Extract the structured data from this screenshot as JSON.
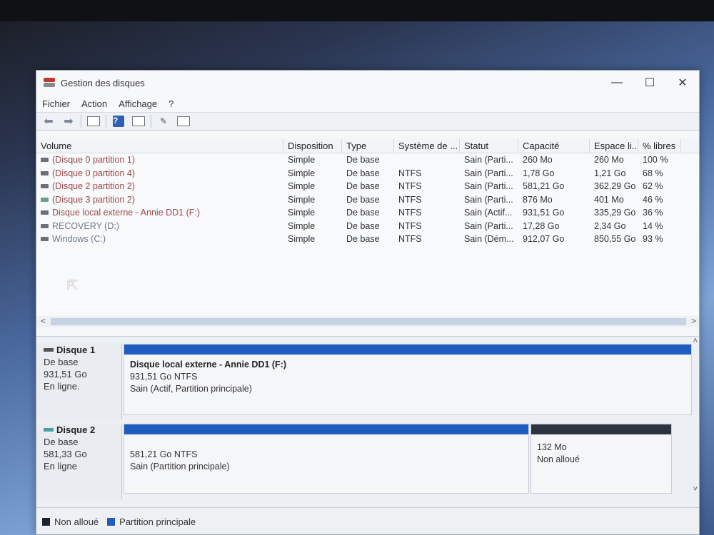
{
  "window": {
    "title": "Gestion des disques",
    "controls": [
      "—",
      "☐",
      "✕"
    ]
  },
  "menu": [
    "Fichier",
    "Action",
    "Affichage",
    "?"
  ],
  "table": {
    "columns": [
      "Volume",
      "Disposition",
      "Type",
      "Système de ...",
      "Statut",
      "Capacité",
      "Espace li...",
      "% libres"
    ],
    "rows": [
      [
        "(Disque 0 partition 1)",
        "Simple",
        "De base",
        "",
        "Sain (Parti...",
        "260 Mo",
        "260 Mo",
        "100 %"
      ],
      [
        "(Disque 0 partition 4)",
        "Simple",
        "De base",
        "NTFS",
        "Sain (Parti...",
        "1,78 Go",
        "1,21 Go",
        "68 %"
      ],
      [
        "(Disque 2 partition 2)",
        "Simple",
        "De base",
        "NTFS",
        "Sain (Parti...",
        "581,21 Go",
        "362,29 Go",
        "62 %"
      ],
      [
        "(Disque 3 partition 2)",
        "Simple",
        "De base",
        "NTFS",
        "Sain (Parti...",
        "876 Mo",
        "401 Mo",
        "46 %"
      ],
      [
        "Disque local externe - Annie DD1 (F:)",
        "Simple",
        "De base",
        "NTFS",
        "Sain (Actif...",
        "931,51 Go",
        "335,29 Go",
        "36 %"
      ],
      [
        "RECOVERY (D:)",
        "Simple",
        "De base",
        "NTFS",
        "Sain (Parti...",
        "17,28 Go",
        "2,34 Go",
        "14 %"
      ],
      [
        "Windows (C:)",
        "Simple",
        "De base",
        "NTFS",
        "Sain (Dém...",
        "912,07 Go",
        "850,55 Go",
        "93 %"
      ]
    ]
  },
  "disks": [
    {
      "name": "Disque 1",
      "type": "De base",
      "size": "931,51 Go",
      "state": "En ligne.",
      "partition": {
        "title": "Disque local externe - Annie DD1  (F:)",
        "size": "931,51 Go NTFS",
        "status": "Sain (Actif, Partition principale)"
      }
    },
    {
      "name": "Disque 2",
      "type": "De base",
      "size": "581,33 Go",
      "state": "En ligne",
      "partition": {
        "size": "581,21 Go NTFS",
        "status": "Sain (Partition principale)"
      },
      "unallocated": {
        "size": "132 Mo",
        "label": "Non alloué"
      }
    }
  ],
  "legend": {
    "unallocated": "Non alloué",
    "primary": "Partition principale"
  },
  "colors": {
    "primary": "#1f5cc0",
    "unallocated": "#1c2230"
  }
}
